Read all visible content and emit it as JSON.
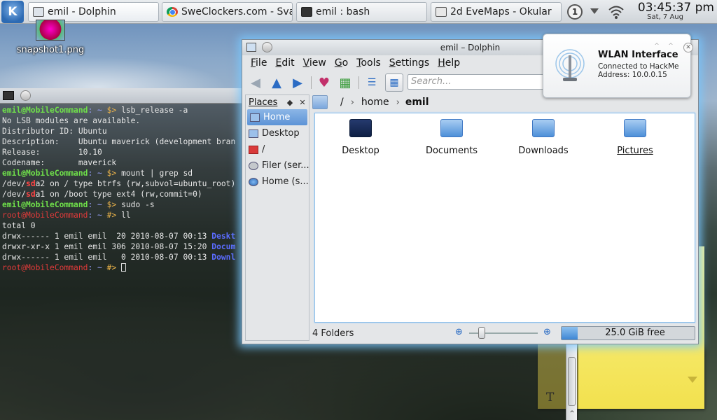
{
  "taskbar": {
    "tasks": [
      {
        "label": "emil - Dolphin",
        "icon": "folder-icon"
      },
      {
        "label": "SweClockers.com - Svara",
        "icon": "chrome-icon"
      },
      {
        "label": "emil : bash",
        "icon": "terminal-icon"
      },
      {
        "label": "2d EveMaps - Okular",
        "icon": "okular-icon"
      }
    ],
    "tray_badge": "1",
    "clock_time": "03:45:37 pm",
    "clock_date": "Sat, 7 Aug"
  },
  "desktop": {
    "icon_label": "snapshot1.png"
  },
  "terminal": {
    "lines": [
      {
        "parts": [
          [
            "user",
            "emil@MobileCommand"
          ],
          [
            "path",
            ": ~ "
          ],
          [
            "dollar",
            "$> "
          ],
          [
            "text",
            "lsb_release -a"
          ]
        ]
      },
      {
        "parts": [
          [
            "text",
            "No LSB modules are available."
          ]
        ]
      },
      {
        "parts": [
          [
            "text",
            "Distributor ID: Ubuntu"
          ]
        ]
      },
      {
        "parts": [
          [
            "text",
            "Description:    Ubuntu maverick (development bran"
          ]
        ]
      },
      {
        "parts": [
          [
            "text",
            "Release:        10.10"
          ]
        ]
      },
      {
        "parts": [
          [
            "text",
            "Codename:       maverick"
          ]
        ]
      },
      {
        "parts": [
          [
            "user",
            "emil@MobileCommand"
          ],
          [
            "path",
            ": ~ "
          ],
          [
            "dollar",
            "$> "
          ],
          [
            "text",
            "mount | grep sd"
          ]
        ]
      },
      {
        "parts": [
          [
            "text",
            "/dev/"
          ],
          [
            "hl",
            "sd"
          ],
          [
            "text",
            "a2 on / type btrfs (rw,subvol=ubuntu_root)"
          ]
        ]
      },
      {
        "parts": [
          [
            "text",
            "/dev/"
          ],
          [
            "hl",
            "sd"
          ],
          [
            "text",
            "a1 on /boot type ext4 (rw,commit=0)"
          ]
        ]
      },
      {
        "parts": [
          [
            "user",
            "emil@MobileCommand"
          ],
          [
            "path",
            ": ~ "
          ],
          [
            "dollar",
            "$> "
          ],
          [
            "text",
            "sudo -s"
          ]
        ]
      },
      {
        "parts": [
          [
            "root",
            "root@MobileCommand"
          ],
          [
            "path",
            ": ~ "
          ],
          [
            "dollar",
            "#> "
          ],
          [
            "text",
            "ll"
          ]
        ]
      },
      {
        "parts": [
          [
            "text",
            "total 0"
          ]
        ]
      },
      {
        "parts": [
          [
            "text",
            "drwx------ 1 emil emil  20 2010-08-07 00:13 "
          ],
          [
            "dir",
            "Deskt"
          ]
        ]
      },
      {
        "parts": [
          [
            "text",
            "drwxr-xr-x 1 emil emil 306 2010-08-07 15:20 "
          ],
          [
            "dir",
            "Docum"
          ]
        ]
      },
      {
        "parts": [
          [
            "text",
            "drwx------ 1 emil emil   0 2010-08-07 00:13 "
          ],
          [
            "dir",
            "Downl"
          ]
        ]
      },
      {
        "parts": [
          [
            "root",
            "root@MobileCommand"
          ],
          [
            "path",
            ": ~ "
          ],
          [
            "dollar",
            "#> "
          ],
          [
            "cursor",
            ""
          ]
        ]
      }
    ]
  },
  "dolphin": {
    "title": "emil – Dolphin",
    "menus": [
      "File",
      "Edit",
      "View",
      "Go",
      "Tools",
      "Settings",
      "Help"
    ],
    "menu_underline": [
      "F",
      "E",
      "V",
      "G",
      "T",
      "S",
      "H"
    ],
    "search_placeholder": "Search...",
    "places_title": "Places",
    "places": [
      {
        "label": "Home",
        "icon": "home-folder-icon",
        "selected": true
      },
      {
        "label": "Desktop",
        "icon": "desktop-folder-icon",
        "selected": false
      },
      {
        "label": "/",
        "icon": "root-folder-icon",
        "selected": false
      },
      {
        "label": "Filer (ser...",
        "icon": "network-drive-icon",
        "selected": false
      },
      {
        "label": "Home (s...",
        "icon": "network-globe-icon",
        "selected": false
      }
    ],
    "breadcrumb": {
      "root": "/",
      "home": "home",
      "current": "emil"
    },
    "folders": [
      "Desktop",
      "Documents",
      "Downloads",
      "Pictures"
    ],
    "status_count": "4 Folders",
    "free_space": "25.0 GiB free",
    "disk_used_fraction": 0.12,
    "zoom_level_fraction": 0.15
  },
  "notification": {
    "title": "WLAN Interface",
    "line1": "Connected to HackMe",
    "line2": "Address: 10.0.0.15"
  },
  "colors": {
    "accent": "#3e86d4",
    "terminal_user": "#6fe04a",
    "terminal_root": "#e03a3a",
    "glow": "#78c8ff"
  }
}
